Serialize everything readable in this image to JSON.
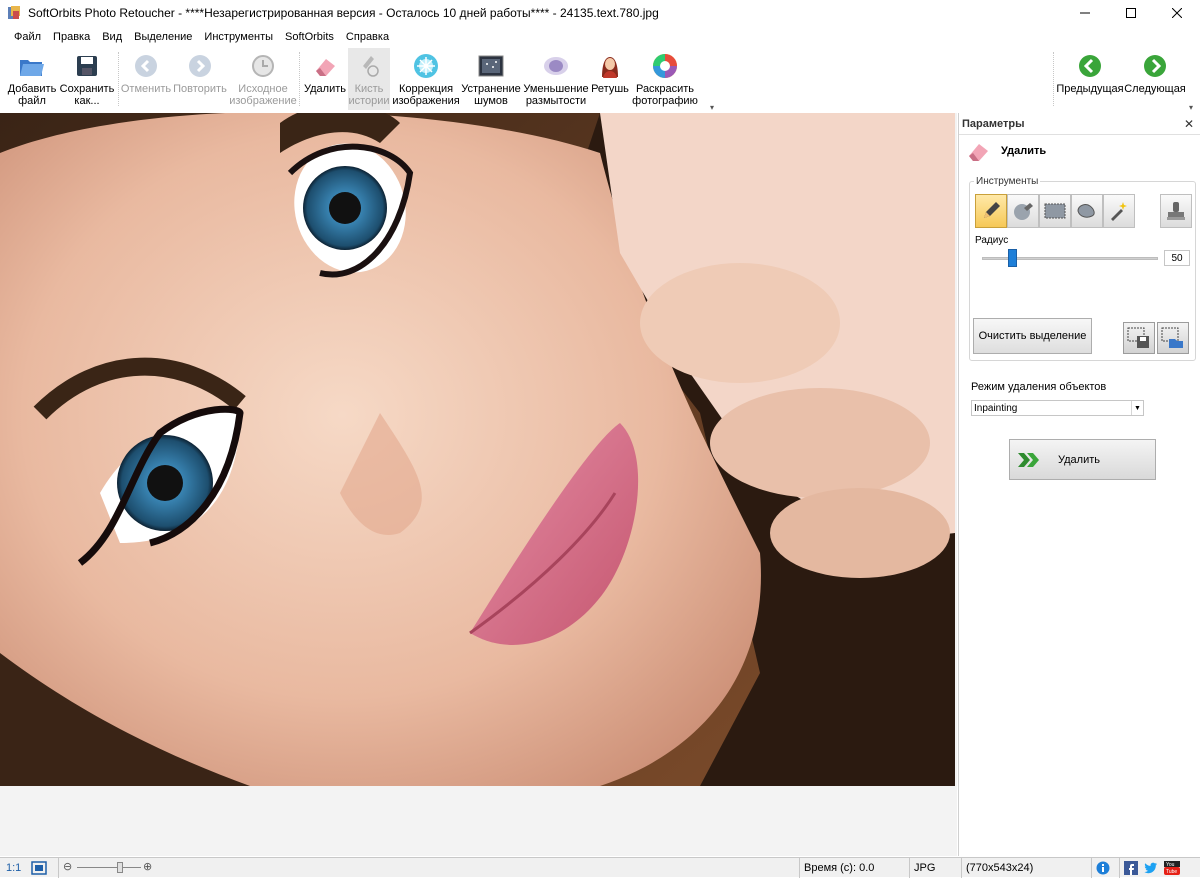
{
  "window": {
    "title": "SoftOrbits Photo Retoucher - ****Незарегистрированная версия - Осталось 10 дней работы**** - 24135.text.780.jpg"
  },
  "menu": [
    "Файл",
    "Правка",
    "Вид",
    "Выделение",
    "Инструменты",
    "SoftOrbits",
    "Справка"
  ],
  "toolbar": {
    "add_file": "Добавить\nфайл",
    "save_as": "Сохранить\nкак...",
    "undo": "Отменить",
    "redo": "Повторить",
    "original": "Исходное\nизображение",
    "remove": "Удалить",
    "history_brush": "Кисть\nистории",
    "image_correction": "Коррекция\nизображения",
    "denoise": "Устранение\nшумов",
    "deblur": "Уменьшение\nразмытости",
    "retouch": "Ретушь",
    "colorize": "Раскрасить\nфотографию",
    "prev": "Предыдущая",
    "next": "Следующая"
  },
  "panel": {
    "title": "Параметры",
    "tool_name": "Удалить",
    "tools_group": "Инструменты",
    "radius_label": "Радиус",
    "radius_value": "50",
    "radius_fraction": 0.17,
    "clear_selection": "Очистить выделение",
    "mode_label": "Режим удаления объектов",
    "mode_value": "Inpainting",
    "delete_button": "Удалить"
  },
  "statusbar": {
    "ratio": "1:1",
    "time": "Время (с): 0.0",
    "format": "JPG",
    "dimensions": "(770x543x24)"
  },
  "colors": {
    "accent_blue": "#1e7fd8",
    "nav_green": "#3aa53a",
    "active_tool": "#f6c857"
  }
}
